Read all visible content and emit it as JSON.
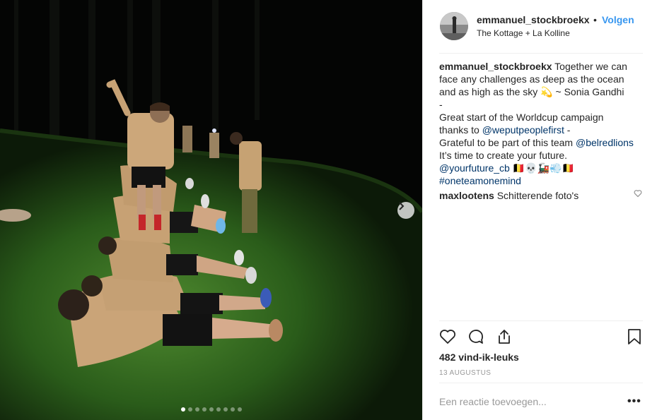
{
  "post": {
    "username": "emmanuel_stockbroekx",
    "separator": "•",
    "follow_label": "Volgen",
    "location": "The Kottage + La Kolline",
    "caption_lines": {
      "l1_rest": "Together we can",
      "l2": "face any challenges as deep as the ocean",
      "l3a": "and as high as the sky",
      "l3_emoji": "💫",
      "l3b": "~ Sonia Gandhi",
      "l4": "-",
      "l5": "Great start of the Worldcup campaign",
      "l6a": "thanks to",
      "l6_link": "@weputpeoplefirst",
      "l6b": "-",
      "l7a": "Grateful to be part of this team",
      "l7_link": "@belredlions",
      "l8": "It’s time to create your future.",
      "l9_link": "@yourfuture_cb",
      "l9_emoji": "🇧🇪💀🚂💨🇧🇪",
      "l10_link": "#oneteamonemind"
    },
    "comment": {
      "username": "maxlootens",
      "text": "Schitterende foto's"
    },
    "likes": "482 vind-ik-leuks",
    "date": "13 AUGUSTUS",
    "comment_placeholder": "Een reactie toevoegen...",
    "more_label": "•••"
  },
  "colors": {
    "link": "#003569",
    "follow": "#3897f0",
    "grass": "#2f6a20",
    "shirt": "#c9a071"
  },
  "icons": [
    "heart-icon",
    "comment-icon",
    "share-icon",
    "bookmark-icon",
    "chevron-right-icon",
    "heart-outline-icon",
    "more-icon"
  ],
  "carousel": {
    "count": 9,
    "active": 1
  }
}
